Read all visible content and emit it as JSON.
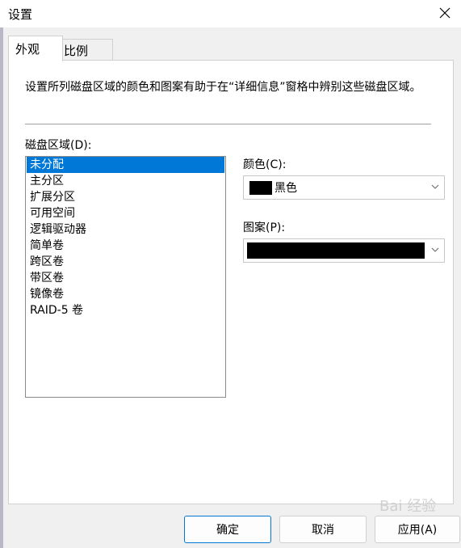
{
  "window": {
    "title": "设置"
  },
  "tabs": [
    {
      "label": "外观",
      "active": true
    },
    {
      "label": "比例",
      "active": false
    }
  ],
  "panel": {
    "description": "设置所列磁盘区域的颜色和图案有助于在“详细信息”窗格中辨别这些磁盘区域。",
    "list_label": "磁盘区域(D):",
    "regions": [
      "未分配",
      "主分区",
      "扩展分区",
      "可用空间",
      "逻辑驱动器",
      "简单卷",
      "跨区卷",
      "带区卷",
      "镜像卷",
      "RAID-5 卷"
    ],
    "selected_index": 0,
    "color": {
      "label": "颜色(C):",
      "value": "黑色",
      "swatch": "#000000"
    },
    "pattern": {
      "label": "图案(P):",
      "swatch": "#000000"
    }
  },
  "buttons": {
    "ok": "确定",
    "cancel": "取消",
    "apply": "应用(A)"
  },
  "watermark": "Bai 经验",
  "colors": {
    "selection": "#0078d7"
  }
}
